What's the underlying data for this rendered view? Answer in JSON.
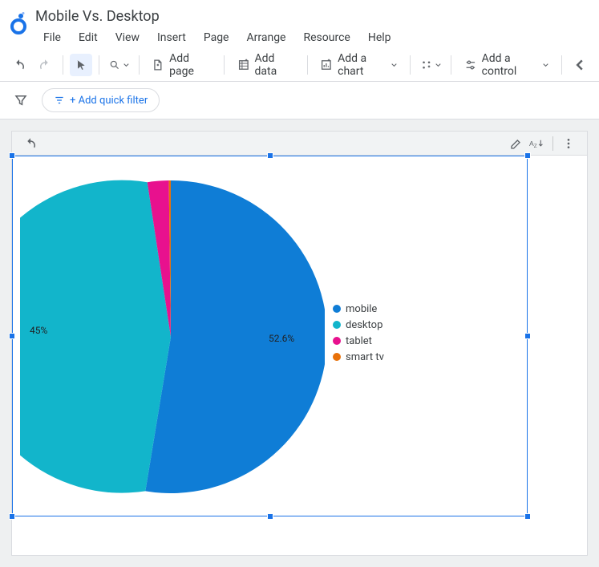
{
  "doc_title": "Mobile Vs. Desktop",
  "menu": {
    "file": "File",
    "edit": "Edit",
    "view": "View",
    "insert": "Insert",
    "page": "Page",
    "arrange": "Arrange",
    "resource": "Resource",
    "help": "Help"
  },
  "toolbar": {
    "add_page": "Add page",
    "add_data": "Add data",
    "add_chart": "Add a chart",
    "add_control": "Add a control"
  },
  "filterbar": {
    "quick_filter": "+ Add quick filter"
  },
  "legend": [
    {
      "label": "mobile",
      "color": "#0F7DD6"
    },
    {
      "label": "desktop",
      "color": "#12B5CB"
    },
    {
      "label": "tablet",
      "color": "#E8118E"
    },
    {
      "label": "smart tv",
      "color": "#E8710A"
    }
  ],
  "labels": {
    "mobile_pct": "52.6%",
    "desktop_pct": "45%"
  },
  "chart_data": {
    "type": "pie",
    "title": "Mobile Vs. Desktop",
    "slices": [
      {
        "name": "mobile",
        "value": 52.6,
        "color": "#0F7DD6"
      },
      {
        "name": "desktop",
        "value": 45.0,
        "color": "#12B5CB"
      },
      {
        "name": "tablet",
        "value": 2.2,
        "color": "#E8118E"
      },
      {
        "name": "smart tv",
        "value": 0.2,
        "color": "#E8710A"
      }
    ],
    "labels_shown": [
      "52.6%",
      "45%"
    ]
  }
}
